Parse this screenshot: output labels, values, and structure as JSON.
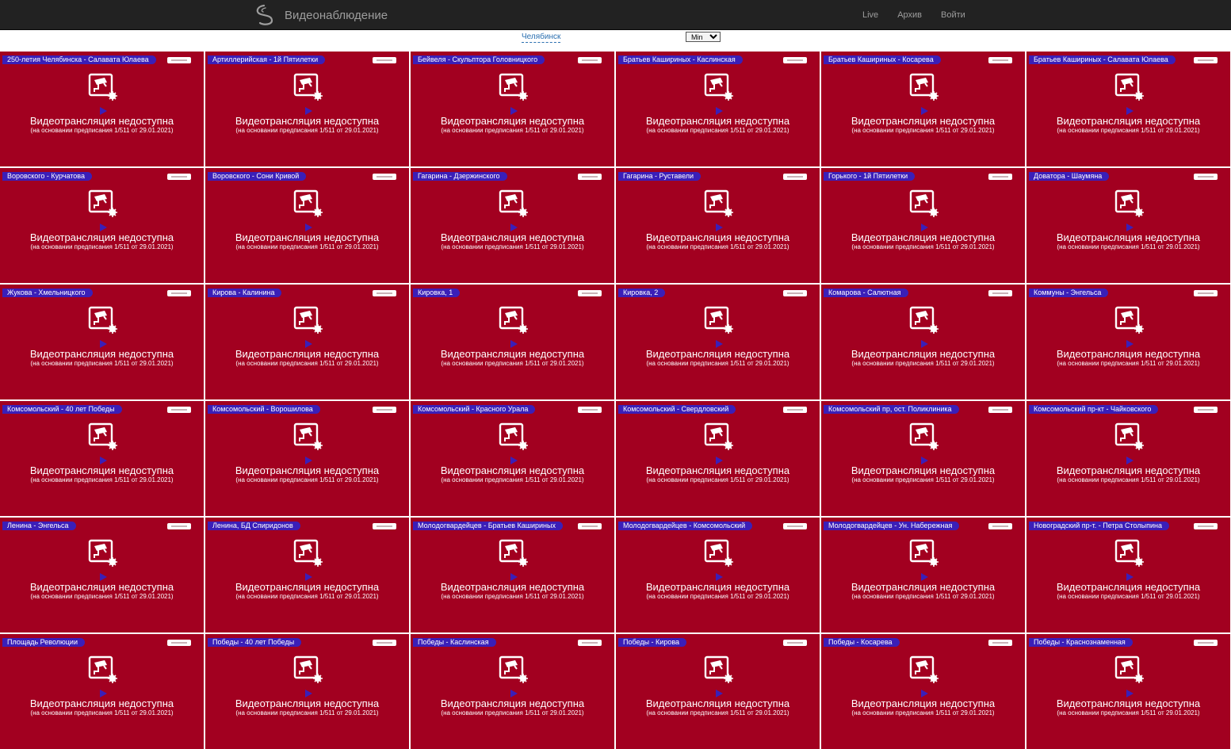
{
  "header": {
    "logo_icon": "brand-swirl-logo",
    "title": "Видеонаблюдение",
    "nav": [
      {
        "label": "Live"
      },
      {
        "label": "Архив"
      },
      {
        "label": "Войти"
      }
    ]
  },
  "toolbar": {
    "city": "Челябинск",
    "size_selected": "Min"
  },
  "colors": {
    "navbar_bg": "#222222",
    "tile_bg": "#a20020",
    "label_bg": "#3a1fb8",
    "text_white": "#ffffff"
  },
  "stream": {
    "icon": "camera-settings-icon",
    "unavailable_title": "Видеотрансляция недоступна",
    "unavailable_subtitle": "(на основании предписания 1/511 от 29.01.2021)"
  },
  "cameras": [
    {
      "name": "250-летия Челябинска - Салавата Юлаева"
    },
    {
      "name": "Артиллерийская - 1й Пятилетки"
    },
    {
      "name": "Бейвеля - Скульптора Головницкого"
    },
    {
      "name": "Братьев Кашириных - Каслинская"
    },
    {
      "name": "Братьев Кашириных - Косарева"
    },
    {
      "name": "Братьев Кашириных - Салавата Юлаева"
    },
    {
      "name": "Воровского - Курчатова"
    },
    {
      "name": "Воровского - Сони Кривой"
    },
    {
      "name": "Гагарина - Дзержинского"
    },
    {
      "name": "Гагарина - Руставели"
    },
    {
      "name": "Горького - 1й Пятилетки"
    },
    {
      "name": "Доватора - Шаумяна"
    },
    {
      "name": "Жукова - Хмельницкого"
    },
    {
      "name": "Кирова - Калинина"
    },
    {
      "name": "Кировка, 1"
    },
    {
      "name": "Кировка, 2"
    },
    {
      "name": "Комарова - Салютная"
    },
    {
      "name": "Коммуны - Энгельса"
    },
    {
      "name": "Комсомольский - 40 лет Победы"
    },
    {
      "name": "Комсомольский - Ворошилова"
    },
    {
      "name": "Комсомольский - Красного Урала"
    },
    {
      "name": "Комсомольский - Свердловский"
    },
    {
      "name": "Комсомольский пр, ост. Поликлиника"
    },
    {
      "name": "Комсомольский пр-кт - Чайковского"
    },
    {
      "name": "Ленина - Энгельса"
    },
    {
      "name": "Ленина, БД Спиридонов"
    },
    {
      "name": "Молодогвардейцев - Братьев Кашириных"
    },
    {
      "name": "Молодогвардейцев - Комсомольский"
    },
    {
      "name": "Молодогвардейцев - Ун. Набережная"
    },
    {
      "name": "Новоградский пр-т. - Петра Столыпина"
    },
    {
      "name": "Площадь Революции"
    },
    {
      "name": "Победы - 40 лет Победы"
    },
    {
      "name": "Победы - Каслинская"
    },
    {
      "name": "Победы - Кирова"
    },
    {
      "name": "Победы - Косарева"
    },
    {
      "name": "Победы - Краснознаменная"
    }
  ]
}
